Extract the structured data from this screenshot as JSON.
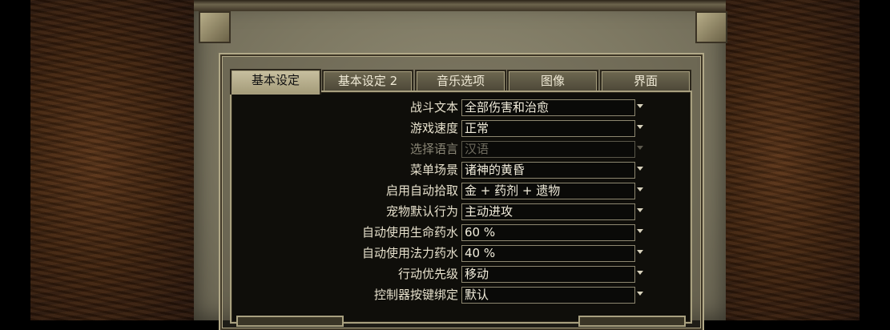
{
  "tabs": [
    {
      "label": "基本设定",
      "active": true
    },
    {
      "label": "基本设定 2",
      "active": false
    },
    {
      "label": "音乐选项",
      "active": false
    },
    {
      "label": "图像",
      "active": false
    },
    {
      "label": "界面",
      "active": false
    }
  ],
  "settings": [
    {
      "label": "战斗文本",
      "value": "全部伤害和治愈",
      "enabled": true
    },
    {
      "label": "游戏速度",
      "value": "正常",
      "enabled": true
    },
    {
      "label": "选择语言",
      "value": "汉语",
      "enabled": false
    },
    {
      "label": "菜单场景",
      "value": "诸神的黄昏",
      "enabled": true
    },
    {
      "label": "启用自动拾取",
      "value": "金 + 药剂 + 遗物",
      "enabled": true
    },
    {
      "label": "宠物默认行为",
      "value": "主动进攻",
      "enabled": true
    },
    {
      "label": "自动使用生命药水",
      "value": "60 %",
      "enabled": true
    },
    {
      "label": "自动使用法力药水",
      "value": "40 %",
      "enabled": true
    },
    {
      "label": "行动优先级",
      "value": "移动",
      "enabled": true
    },
    {
      "label": "控制器按键绑定",
      "value": "默认",
      "enabled": true
    }
  ],
  "icons": {
    "dropdown": "chevron-down-icon"
  }
}
